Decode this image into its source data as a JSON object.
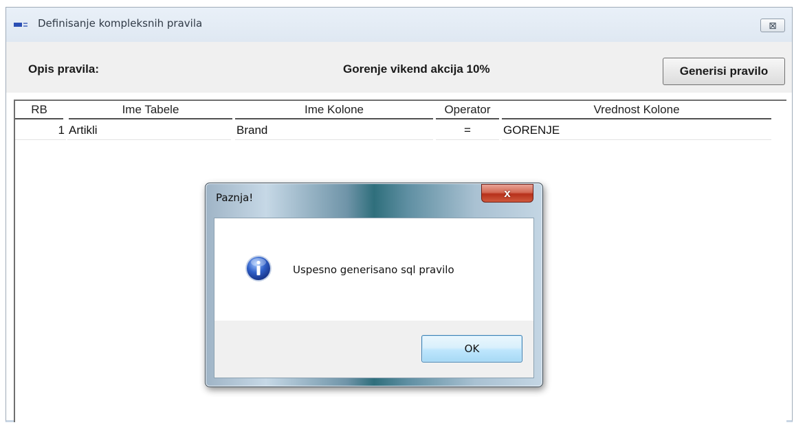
{
  "window": {
    "title": "Definisanje kompleksnih pravila",
    "close_glyph": "⊠"
  },
  "toolbar": {
    "opis_label": "Opis pravila:",
    "rule_name": "Gorenje vikend akcija 10%",
    "generate_button": "Generisi pravilo"
  },
  "grid": {
    "columns": [
      "RB",
      "Ime Tabele",
      "Ime Kolone",
      "Operator",
      "Vrednost Kolone"
    ],
    "rows": [
      [
        "1",
        "Artikli",
        "Brand",
        "=",
        "GORENJE"
      ]
    ]
  },
  "dialog": {
    "title": "Paznja!",
    "close_glyph": "x",
    "icon": "info-icon",
    "message": "Uspesno generisano sql pravilo",
    "ok_button": "OK"
  },
  "colors": {
    "title_bar": "#e4ecf5",
    "toolbar_bg": "#f0f0f0",
    "dialog_close_red": "#c7402b",
    "ok_button_blue": "#bee6fd",
    "info_icon_blue": "#2f5fc7"
  }
}
